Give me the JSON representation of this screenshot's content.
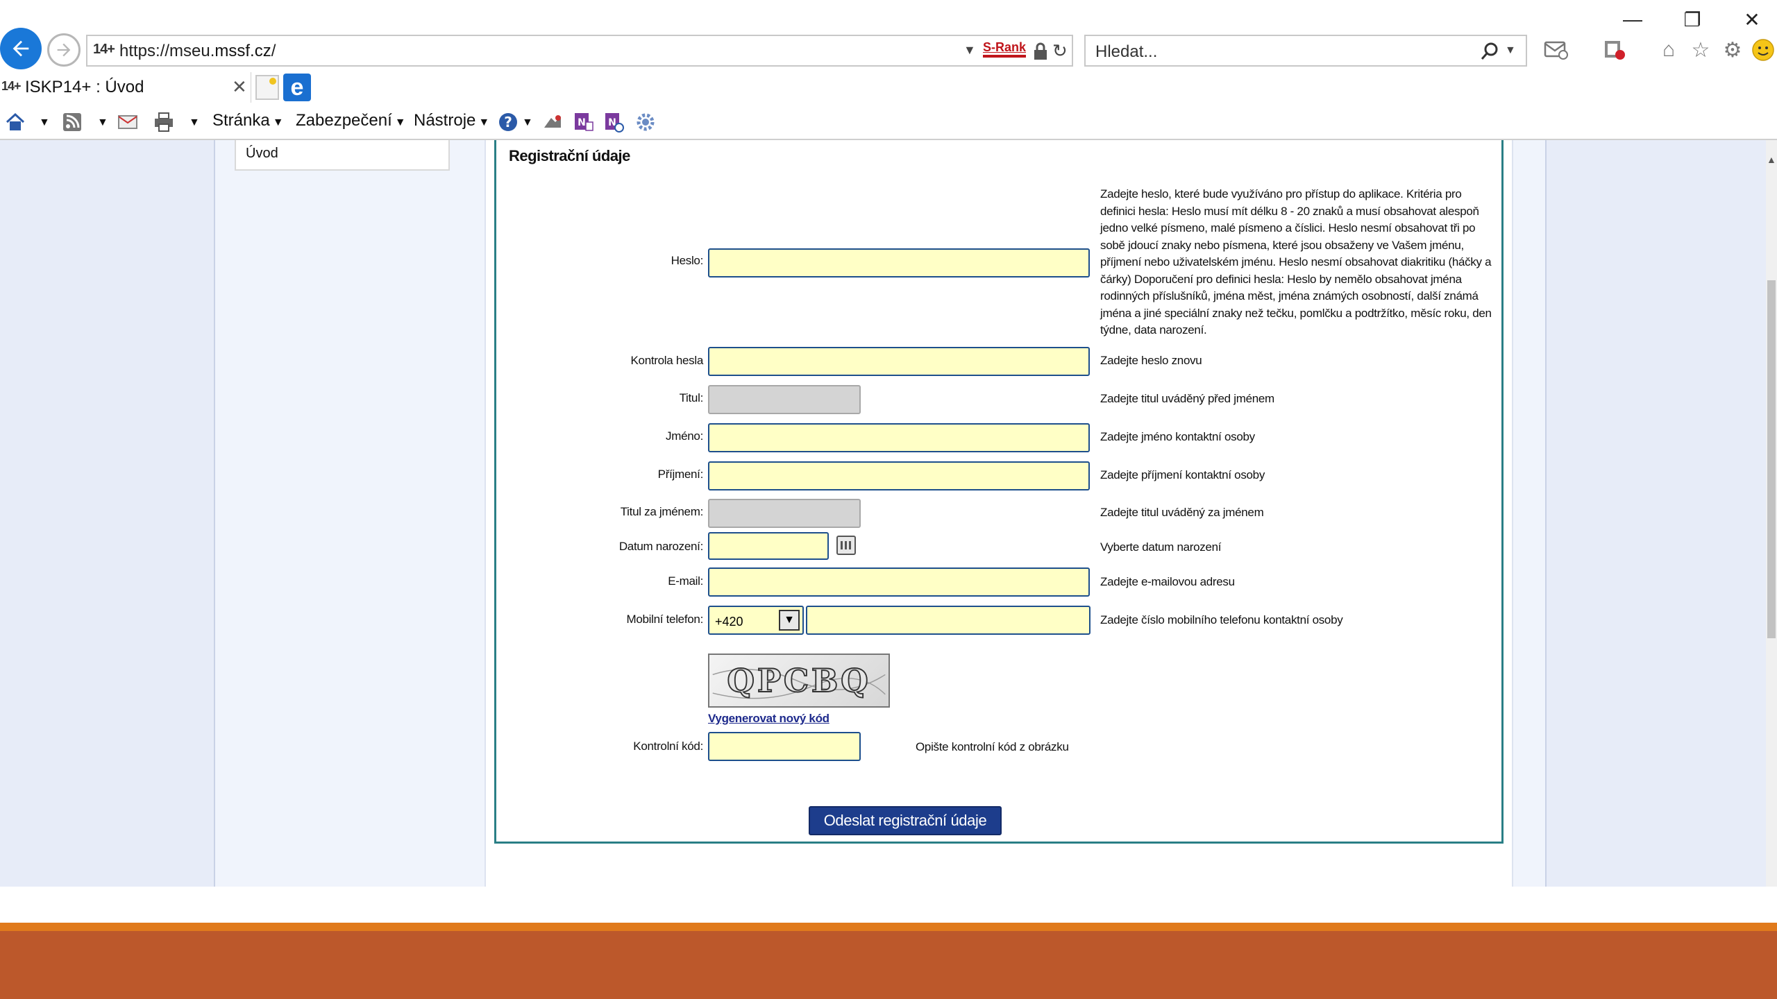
{
  "browser": {
    "url_prefix": "https://mseu.",
    "url_domain": "mssf.cz",
    "url_suffix": "/",
    "favicon_text": "14+",
    "srank_label": "S-Rank",
    "search_placeholder": "Hledat...",
    "tab": {
      "title": "ISKP14+ : Úvod"
    },
    "window": {
      "minimize": "—",
      "restore": "❐",
      "close": "✕"
    },
    "commandbar": {
      "page_menu": "Stránka",
      "security_menu": "Zabezpečení",
      "tools_menu": "Nástroje"
    }
  },
  "sidebar": {
    "items": [
      {
        "label": "Úvod"
      }
    ]
  },
  "form": {
    "heading": "Registrační údaje",
    "fields": {
      "password": {
        "label": "Heslo:",
        "hint": "Zadejte heslo, které bude využíváno pro přístup do aplikace. Kritéria pro definici hesla: Heslo musí mít délku 8 - 20 znaků a musí obsahovat alespoň jedno velké písmeno, malé písmeno a číslici. Heslo nesmí obsahovat tři po sobě jdoucí znaky nebo písmena, které jsou obsaženy ve Vašem jménu, příjmení nebo uživatelském jménu. Heslo nesmí obsahovat diakritiku (háčky a čárky) Doporučení pro definici hesla: Heslo by nemělo obsahovat jména rodinných příslušníků, jména měst, jména známých osobností, další známá jména a jiné speciální znaky než tečku, pomlčku a podtržítko, měsíc roku, den týdne, data narození."
      },
      "password_confirm": {
        "label": "Kontrola hesla",
        "hint": "Zadejte heslo znovu"
      },
      "title_before": {
        "label": "Titul:",
        "hint": "Zadejte titul uváděný před jménem"
      },
      "first_name": {
        "label": "Jméno:",
        "hint": "Zadejte jméno kontaktní osoby"
      },
      "last_name": {
        "label": "Příjmení:",
        "hint": "Zadejte příjmení kontaktní osoby"
      },
      "title_after": {
        "label": "Titul za jménem:",
        "hint": "Zadejte titul uváděný za jménem"
      },
      "birth_date": {
        "label": "Datum narození:",
        "hint": "Vyberte datum narození"
      },
      "email": {
        "label": "E-mail:",
        "hint": "Zadejte e-mailovou adresu"
      },
      "mobile": {
        "label": "Mobilní telefon:",
        "prefix": "+420",
        "hint": "Zadejte číslo mobilního telefonu kontaktní osoby"
      },
      "captcha": {
        "label": "Kontrolní kód:",
        "image_text": "QPCBQ",
        "regen_link": "Vygenerovat nový kód",
        "hint": "Opište kontrolní kód z obrázku"
      }
    },
    "submit_label": "Odeslat registrační údaje"
  }
}
